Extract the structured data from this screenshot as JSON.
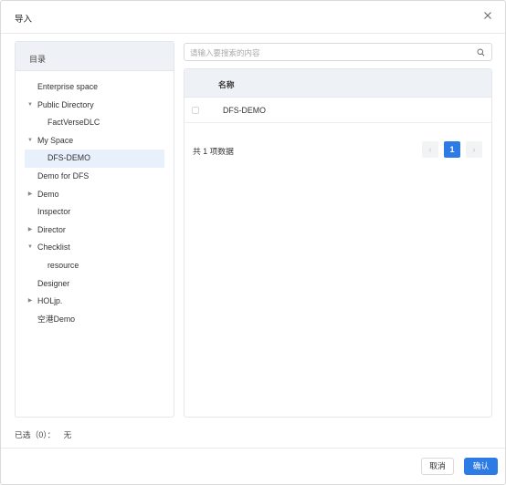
{
  "dialog": {
    "title": "导入"
  },
  "left_panel": {
    "header": "目录",
    "tree": [
      {
        "label": "Enterprise space",
        "indent": 0,
        "arrow": ""
      },
      {
        "label": "Public Directory",
        "indent": 0,
        "arrow": "expanded"
      },
      {
        "label": "FactVerseDLC",
        "indent": 1,
        "arrow": ""
      },
      {
        "label": "My Space",
        "indent": 0,
        "arrow": "expanded"
      },
      {
        "label": "DFS-DEMO",
        "indent": 1,
        "arrow": "",
        "selected": true
      },
      {
        "label": "Demo for DFS",
        "indent": 0,
        "arrow": ""
      },
      {
        "label": "Demo",
        "indent": 0,
        "arrow": "collapsed"
      },
      {
        "label": "Inspector",
        "indent": 0,
        "arrow": ""
      },
      {
        "label": "Director",
        "indent": 0,
        "arrow": "collapsed"
      },
      {
        "label": "Checklist",
        "indent": 0,
        "arrow": "expanded"
      },
      {
        "label": "resource",
        "indent": 1,
        "arrow": ""
      },
      {
        "label": "Designer",
        "indent": 0,
        "arrow": ""
      },
      {
        "label": "HOLjp.",
        "indent": 0,
        "arrow": "collapsed"
      },
      {
        "label": "空港Demo",
        "indent": 0,
        "arrow": ""
      }
    ]
  },
  "search": {
    "placeholder": "请输入要搜索的内容",
    "value": ""
  },
  "table": {
    "column_header": "名称",
    "rows": [
      {
        "name": "DFS-DEMO",
        "checked": false
      }
    ]
  },
  "pagination": {
    "total_text": "共 1 项数据",
    "prev": "‹",
    "current_page": "1",
    "next": "›"
  },
  "selection": {
    "label": "已选（0）：",
    "value": "无"
  },
  "footer": {
    "cancel_label": "取消",
    "confirm_label": "确认"
  },
  "colors": {
    "accent": "#2d7be5",
    "panel_header_bg": "#eef1f5",
    "selected_row_bg": "#e8f0fb"
  },
  "icons": {
    "close": "close-icon",
    "search": "search-icon",
    "expanded": "caret-down-icon",
    "collapsed": "caret-right-icon"
  }
}
